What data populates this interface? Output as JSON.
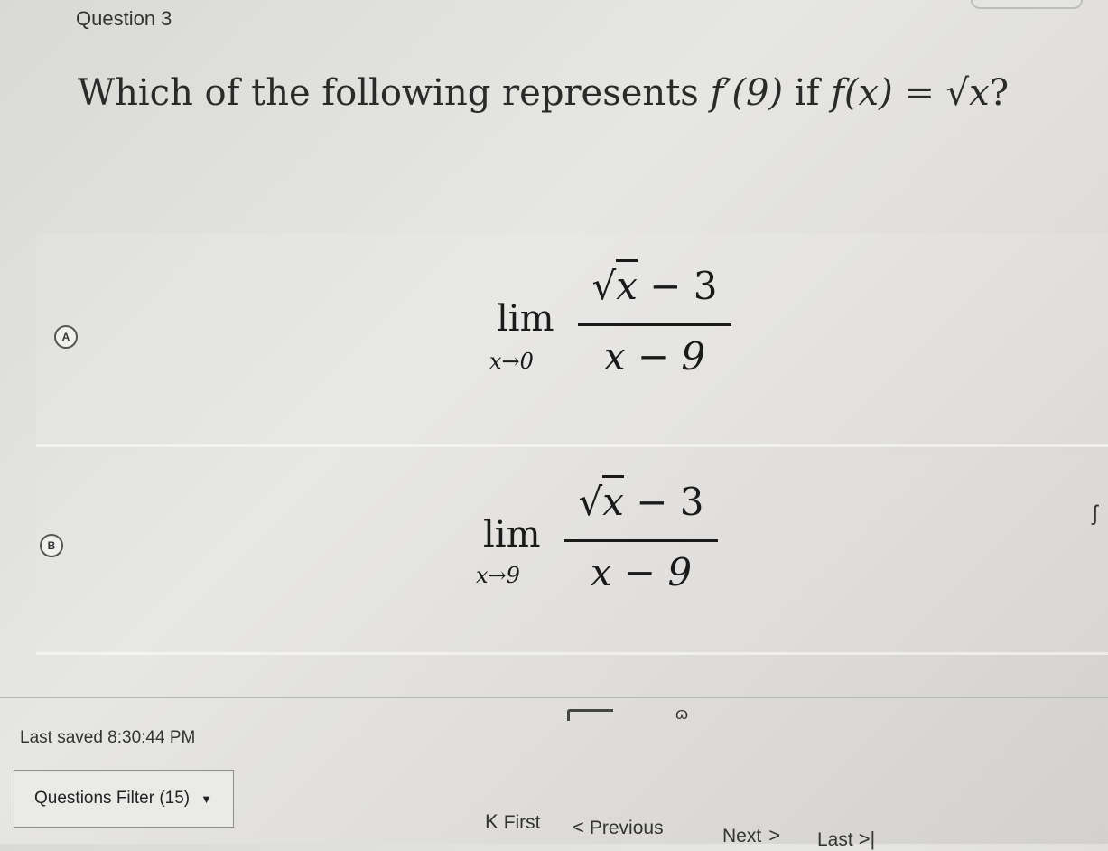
{
  "header": {
    "question_number": "Question 3"
  },
  "question": {
    "text_before": "Which of the following represents ",
    "fprime": "f′(9)",
    "text_mid": " if ",
    "fdef": "f(x) = √x",
    "text_end": "?"
  },
  "options": [
    {
      "letter": "A",
      "lim_word": "lim",
      "lim_sub": "x→0",
      "numerator_var": "x",
      "numerator_rest": " − 3",
      "denominator": "x − 9"
    },
    {
      "letter": "B",
      "lim_word": "lim",
      "lim_sub": "x→9",
      "numerator_var": "x",
      "numerator_rest": " − 3",
      "denominator": "x − 9"
    }
  ],
  "footer": {
    "last_saved": "Last saved 8:30:44 PM",
    "filter_label": "Questions Filter (15)",
    "filter_caret": "▼",
    "nav_first": "First",
    "nav_previous": "Previous",
    "nav_next": "Next",
    "nav_last": "Last"
  },
  "icons": {
    "first": "first-page-icon",
    "previous": "chevron-left-icon",
    "next": "chevron-right-icon",
    "last": "last-page-icon"
  }
}
